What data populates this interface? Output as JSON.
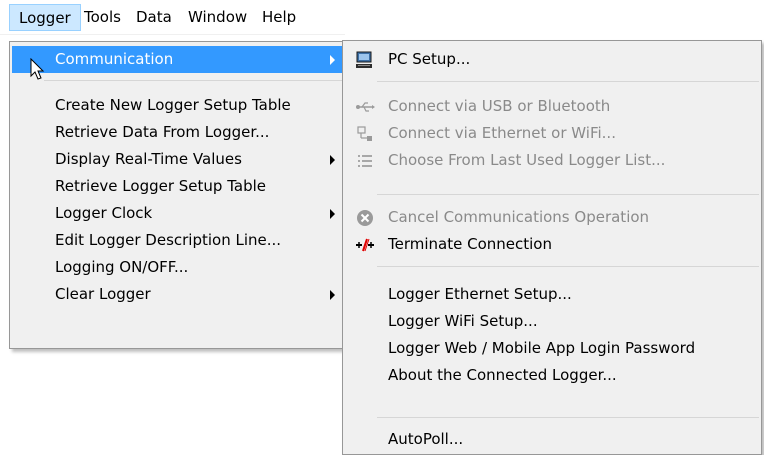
{
  "menubar": {
    "items": [
      "Logger",
      "Tools",
      "Data",
      "Window",
      "Help"
    ]
  },
  "logger_menu": {
    "items": [
      {
        "label": "Communication",
        "submenu": true
      },
      {
        "label": "Create New Logger Setup Table"
      },
      {
        "label": "Retrieve Data From Logger..."
      },
      {
        "label": "Display Real-Time Values",
        "submenu": true
      },
      {
        "label": "Retrieve Logger Setup Table"
      },
      {
        "label": "Logger Clock",
        "submenu": true
      },
      {
        "label": "Edit Logger Description Line..."
      },
      {
        "label": "Logging ON/OFF..."
      },
      {
        "label": "Clear Logger",
        "submenu": true
      }
    ]
  },
  "communication_menu": {
    "items": [
      {
        "label": "PC Setup...",
        "icon": "pc-icon",
        "enabled": true
      },
      {
        "label": "Connect via USB or Bluetooth",
        "icon": "usb-icon",
        "enabled": false
      },
      {
        "label": "Connect via Ethernet or WiFi...",
        "icon": "network-icon",
        "enabled": false
      },
      {
        "label": "Choose From Last Used Logger List...",
        "icon": "list-icon",
        "enabled": false
      },
      {
        "label": "Cancel Communications Operation",
        "icon": "cancel-icon",
        "enabled": false
      },
      {
        "label": "Terminate Connection",
        "icon": "disconnect-icon",
        "enabled": true
      },
      {
        "label": "Logger Ethernet Setup...",
        "enabled": true
      },
      {
        "label": "Logger WiFi Setup...",
        "enabled": true
      },
      {
        "label": "Logger Web / Mobile App Login Password",
        "enabled": true
      },
      {
        "label": "About the Connected Logger...",
        "enabled": true
      },
      {
        "label": "AutoPoll...",
        "enabled": true
      }
    ]
  },
  "colors": {
    "highlight": "#3399ff",
    "menu_bg": "#f0f0f0",
    "disabled_text": "#8a8a8a",
    "active_menubar": "#cce8ff"
  }
}
